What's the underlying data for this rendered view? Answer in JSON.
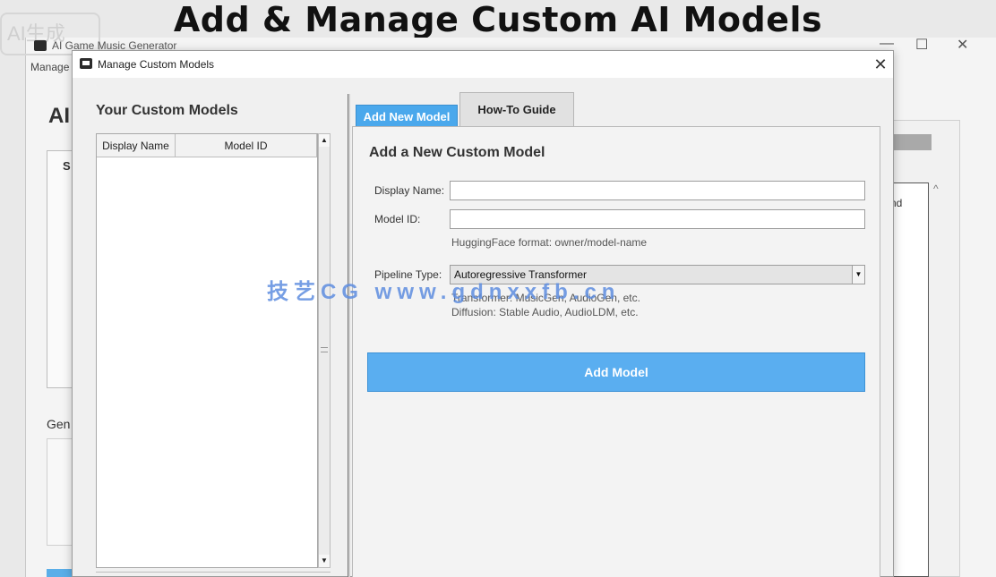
{
  "banner": {
    "title": "Add & Manage Custom AI Models"
  },
  "watermarks": {
    "top_left": "AI生成",
    "center": "技艺CG  www.gdnxxfb.cn"
  },
  "background_app": {
    "title": "AI Game Music Generator",
    "menu_fragment": "Manage",
    "heading_fragment": "AI",
    "panel_fragment": "S",
    "section_fragment": "Gen",
    "right_fragment": "nd",
    "window_controls": {
      "minimize": "—",
      "maximize": "☐",
      "close": "✕"
    }
  },
  "dialog": {
    "title": "Manage Custom Models",
    "close_label": "✕",
    "left_pane": {
      "heading": "Your Custom Models",
      "columns": [
        "Display Name",
        "Model ID"
      ],
      "rows": []
    },
    "tabs": [
      {
        "label": "Add New Model",
        "active": true
      },
      {
        "label": "How-To Guide",
        "active": false
      }
    ],
    "form": {
      "heading": "Add a New Custom Model",
      "display_name": {
        "label": "Display Name:",
        "value": "",
        "placeholder": ""
      },
      "model_id": {
        "label": "Model ID:",
        "value": "",
        "placeholder": "",
        "hint": "HuggingFace format: owner/model-name"
      },
      "pipeline_type": {
        "label": "Pipeline Type:",
        "selected": "Autoregressive Transformer",
        "hint_line1": "Transformer: MusicGen, AudioGen, etc.",
        "hint_line2": "Diffusion: Stable Audio, AudioLDM, etc."
      },
      "submit_label": "Add Model"
    }
  },
  "colors": {
    "accent_blue": "#4aa8ec",
    "button_blue": "#5aaef0",
    "dialog_bg": "#f0f0f0"
  },
  "icons": [
    "app-icon",
    "close-icon",
    "scroll-up-icon",
    "scroll-down-icon",
    "dropdown-arrow-icon"
  ]
}
